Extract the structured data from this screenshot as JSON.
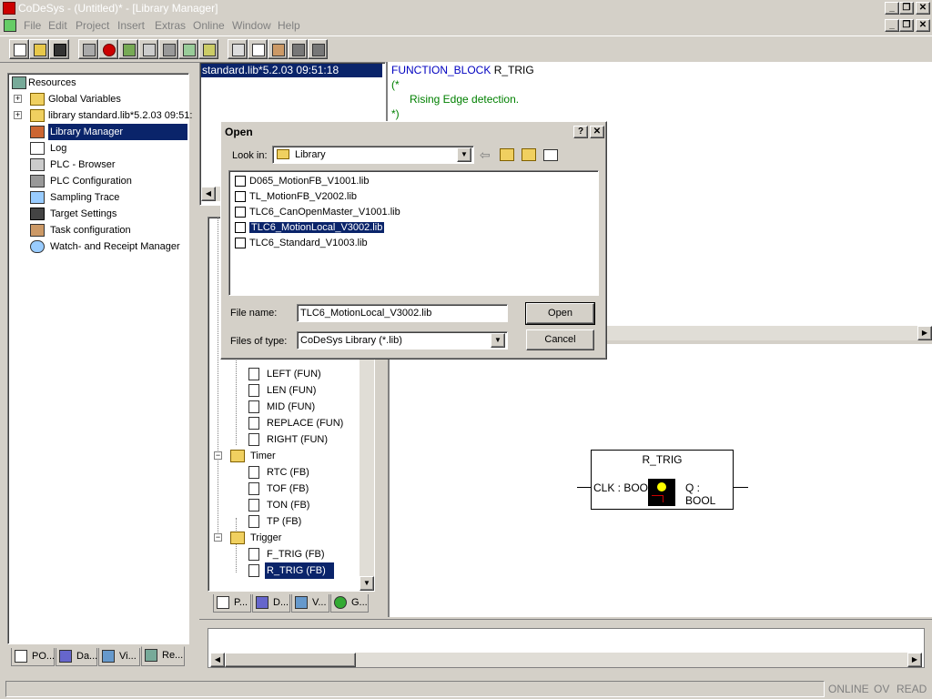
{
  "app": {
    "title": "CoDeSys - (Untitled)* - [Library Manager]",
    "menu": [
      "File",
      "Edit",
      "Project",
      "Insert",
      "Extras",
      "Online",
      "Window",
      "Help"
    ]
  },
  "resources": {
    "items": [
      {
        "label": "Resources"
      },
      {
        "label": "Global Variables"
      },
      {
        "label": "library standard.lib*5.2.03 09:51:"
      },
      {
        "label": "Library Manager"
      },
      {
        "label": "Log"
      },
      {
        "label": "PLC - Browser"
      },
      {
        "label": "PLC Configuration"
      },
      {
        "label": "Sampling Trace"
      },
      {
        "label": "Target Settings"
      },
      {
        "label": "Task configuration"
      },
      {
        "label": "Watch- and Receipt Manager"
      }
    ],
    "tabs": [
      "PO...",
      "Da...",
      "Vi...",
      "Re..."
    ]
  },
  "library_list": {
    "entry": "standard.lib*5.2.03 09:51:18"
  },
  "code": {
    "line1_keyword": "FUNCTION_BLOCK",
    "line1_name": "R_TRIG",
    "line2": "(*",
    "line3": "Rising Edge detection.",
    "line4": "*)"
  },
  "lib_tree": {
    "items": [
      {
        "label": "LEFT (FUN)"
      },
      {
        "label": "LEN (FUN)"
      },
      {
        "label": "MID (FUN)"
      },
      {
        "label": "REPLACE (FUN)"
      },
      {
        "label": "RIGHT (FUN)"
      },
      {
        "label": "Timer"
      },
      {
        "label": "RTC (FB)"
      },
      {
        "label": "TOF (FB)"
      },
      {
        "label": "TON (FB)"
      },
      {
        "label": "TP (FB)"
      },
      {
        "label": "Trigger"
      },
      {
        "label": "F_TRIG (FB)"
      },
      {
        "label": "R_TRIG (FB)"
      }
    ],
    "tabs": [
      "P...",
      "D...",
      "V...",
      "G..."
    ]
  },
  "fb_block": {
    "name": "R_TRIG",
    "input": "CLK : BOOL",
    "output": "Q : BOOL"
  },
  "dialog": {
    "title": "Open",
    "help": "?",
    "close": "✕",
    "look_in_label": "Look in:",
    "look_in_value": "Library",
    "files": [
      {
        "name": "D065_MotionFB_V1001.lib"
      },
      {
        "name": "TL_MotionFB_V2002.lib"
      },
      {
        "name": "TLC6_CanOpenMaster_V1001.lib"
      },
      {
        "name": "TLC6_MotionLocal_V3002.lib"
      },
      {
        "name": "TLC6_Standard_V1003.lib"
      }
    ],
    "file_name_label": "File name:",
    "file_name_value": "TLC6_MotionLocal_V3002.lib",
    "files_of_type_label": "Files of type:",
    "files_of_type_value": "CoDeSys Library (*.lib)",
    "open_button": "Open",
    "cancel_button": "Cancel"
  },
  "status": {
    "online": "ONLINE",
    "ov": "OV",
    "read": "READ"
  }
}
